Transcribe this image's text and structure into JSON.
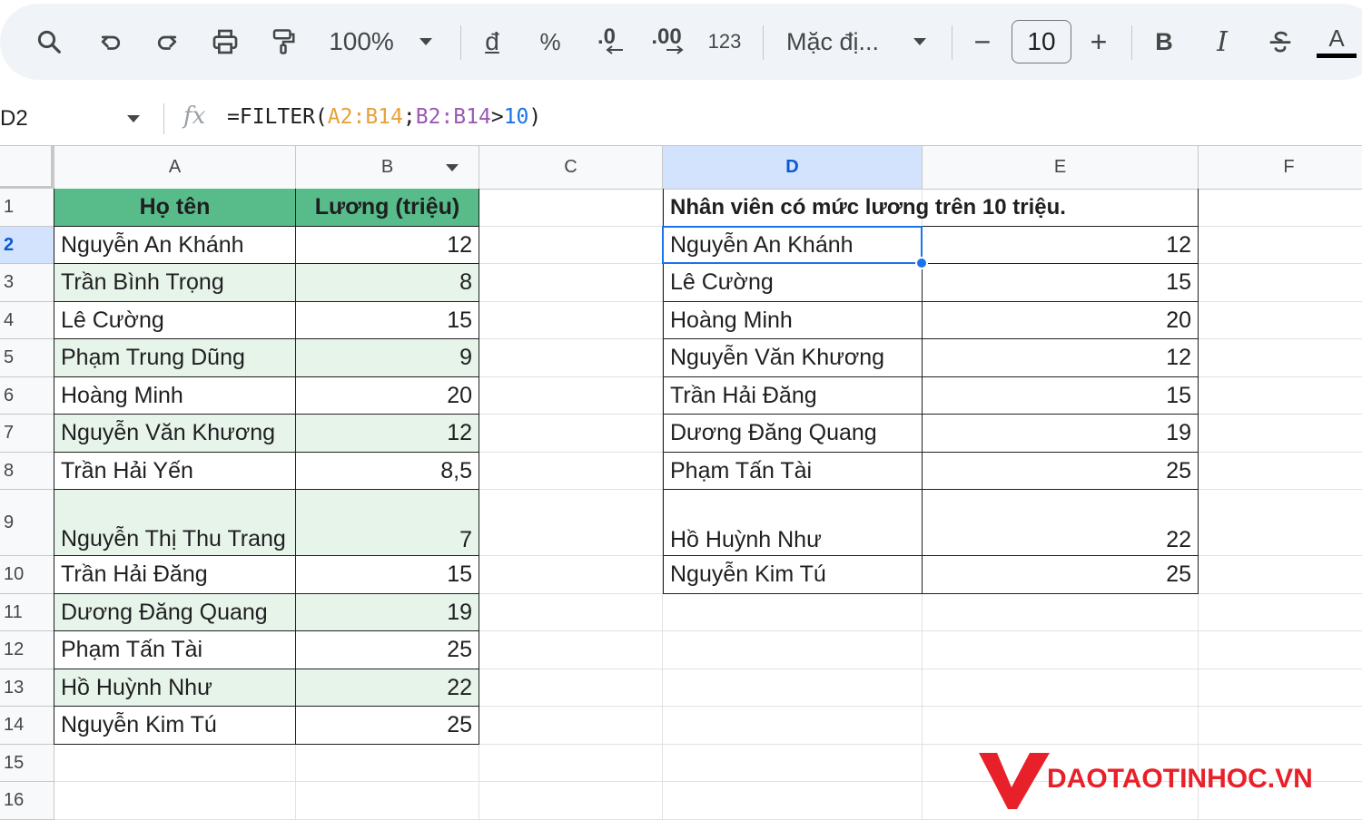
{
  "toolbar": {
    "zoom": "100%",
    "currency_label": "đ",
    "percent_label": "%",
    "dec_decrease_label": ".0",
    "dec_increase_label": ".00",
    "number_format_label": "123",
    "font_name": "Mặc đị...",
    "font_size": "10",
    "minus_label": "−",
    "plus_label": "+",
    "bold_label": "B",
    "italic_label": "I",
    "text_color_label": "A"
  },
  "formula_bar": {
    "cell_ref": "D2",
    "fx_label": "fx",
    "formula_parts": [
      {
        "text": "=FILTER(",
        "color": "#1f1f1f"
      },
      {
        "text": "A2:B14",
        "color": "#e8a13a"
      },
      {
        "text": ";",
        "color": "#1f1f1f"
      },
      {
        "text": "B2:B14",
        "color": "#9b59b6"
      },
      {
        "text": ">",
        "color": "#1f1f1f"
      },
      {
        "text": "10",
        "color": "#1a73e8"
      },
      {
        "text": ")",
        "color": "#1f1f1f"
      }
    ]
  },
  "columns": [
    "A",
    "B",
    "C",
    "D",
    "E",
    "F"
  ],
  "rows": [
    "1",
    "2",
    "3",
    "4",
    "5",
    "6",
    "7",
    "8",
    "9",
    "10",
    "11",
    "12",
    "13",
    "14",
    "15",
    "16"
  ],
  "table_left": {
    "header_name": "Họ tên",
    "header_salary": "Lương (triệu)",
    "rows": [
      {
        "name": "Nguyễn An Khánh",
        "salary": "12"
      },
      {
        "name": "Trần Bình Trọng",
        "salary": "8"
      },
      {
        "name": "Lê Cường",
        "salary": "15"
      },
      {
        "name": "Phạm Trung Dũng",
        "salary": "9"
      },
      {
        "name": "Hoàng Minh",
        "salary": "20"
      },
      {
        "name": "Nguyễn Văn Khương",
        "salary": "12"
      },
      {
        "name": "Trần Hải Yến",
        "salary": "8,5"
      },
      {
        "name": "Nguyễn Thị Thu Trang",
        "salary": "7"
      },
      {
        "name": "Trần Hải Đăng",
        "salary": "15"
      },
      {
        "name": "Dương Đăng Quang",
        "salary": "19"
      },
      {
        "name": "Phạm Tấn Tài",
        "salary": "25"
      },
      {
        "name": "Hồ Huỳnh Như",
        "salary": "22"
      },
      {
        "name": "Nguyễn Kim Tú",
        "salary": "25"
      }
    ]
  },
  "table_right": {
    "title": "Nhân viên có mức lương trên 10 triệu.",
    "rows": [
      {
        "name": "Nguyễn An Khánh",
        "salary": "12"
      },
      {
        "name": "Lê Cường",
        "salary": "15"
      },
      {
        "name": "Hoàng Minh",
        "salary": "20"
      },
      {
        "name": "Nguyễn Văn Khương",
        "salary": "12"
      },
      {
        "name": "Trần Hải Đăng",
        "salary": "15"
      },
      {
        "name": "Dương Đăng Quang",
        "salary": "19"
      },
      {
        "name": "Phạm Tấn Tài",
        "salary": "25"
      },
      {
        "name": "Hồ Huỳnh Như",
        "salary": "22"
      },
      {
        "name": "Nguyễn Kim Tú",
        "salary": "25"
      }
    ]
  },
  "watermark": {
    "text": "DAOTAOTINHOC.VN",
    "color": "#e8202a"
  },
  "colors": {
    "header_green": "#57bb8a",
    "band_green": "#e6f4ea",
    "selection_blue": "#1a73e8",
    "active_header": "#d3e3fd"
  }
}
